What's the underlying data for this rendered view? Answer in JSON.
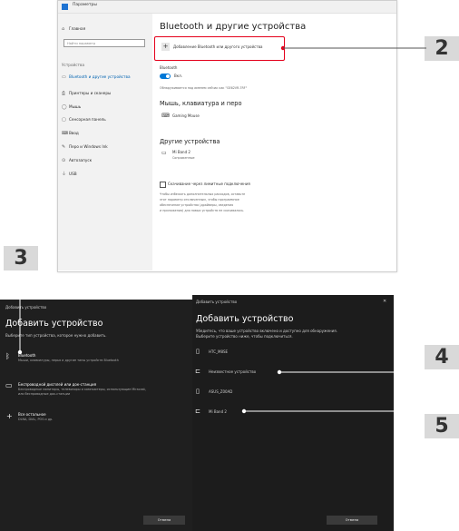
{
  "settings": {
    "window_title": "Параметры",
    "home": "Главная",
    "search_placeholder": "Найти параметр",
    "section": "Устройства",
    "nav": [
      "Bluetooth и другие устройства",
      "Принтеры и сканеры",
      "Мышь",
      "Сенсорная панель",
      "Ввод",
      "Перо и Windows Ink",
      "Автозапуск",
      "USB"
    ],
    "page_title": "Bluetooth и другие устройства",
    "add_device": "Добавление Bluetooth или другого устройства",
    "bluetooth_label": "Bluetooth",
    "toggle_state": "Вкл.",
    "discoverable": "Обнаруживается под именем сейчас как \"GE62VR-7RF\"",
    "mouse_heading": "Мышь, клавиатура и перо",
    "mouse_device": "Gaming Mouse",
    "other_heading": "Другие устройства",
    "other_device": "Mi Band 2",
    "other_device_status": "Сопряженные",
    "metered_checkbox": "Скачивание через лимитные подключения",
    "metered_note_1": "Чтобы избежать дополнительных расходов, оставьте",
    "metered_note_2": "этот параметр отключенным, чтобы программное",
    "metered_note_3": "обеспечение устройства (драйверы, сведения",
    "metered_note_4": "и приложения) для новых устройств не скачивалось."
  },
  "dialog1": {
    "title": "Добавить устройство",
    "heading": "Добавить устройство",
    "prompt": "Выберите тип устройства, которое нужно добавить.",
    "option1_title": "Bluetooth",
    "option1_desc": "Мыши, клавиатуры, перья и другие типы устройств Bluetooth",
    "option2_title": "Беспроводной дисплей или док-станция",
    "option2_desc1": "Беспроводные мониторы, телевизоры и компьютеры, использующие Miracast,",
    "option2_desc2": "или беспроводные док-станции",
    "option3_title": "Все остальное",
    "option3_desc": "DLNA, DIAL, POS и др.",
    "cancel": "Отмена"
  },
  "dialog2": {
    "title": "Добавить устройство",
    "heading": "Добавить устройство",
    "prompt1": "Убедитесь, что ваше устройство включено и доступно для обнаружения.",
    "prompt2": "Выберите устройство ниже, чтобы подключиться.",
    "devices": [
      "HTC_M8SE",
      "Неизвестное устройство",
      "ASUS_Z00AD",
      "Mi Band 2"
    ],
    "cancel": "Отмена"
  },
  "callouts": [
    "2",
    "3",
    "4",
    "5"
  ],
  "colors": {
    "highlight": "#e4001b",
    "accent": "#0078d7",
    "callout": "#d9d9d9"
  }
}
